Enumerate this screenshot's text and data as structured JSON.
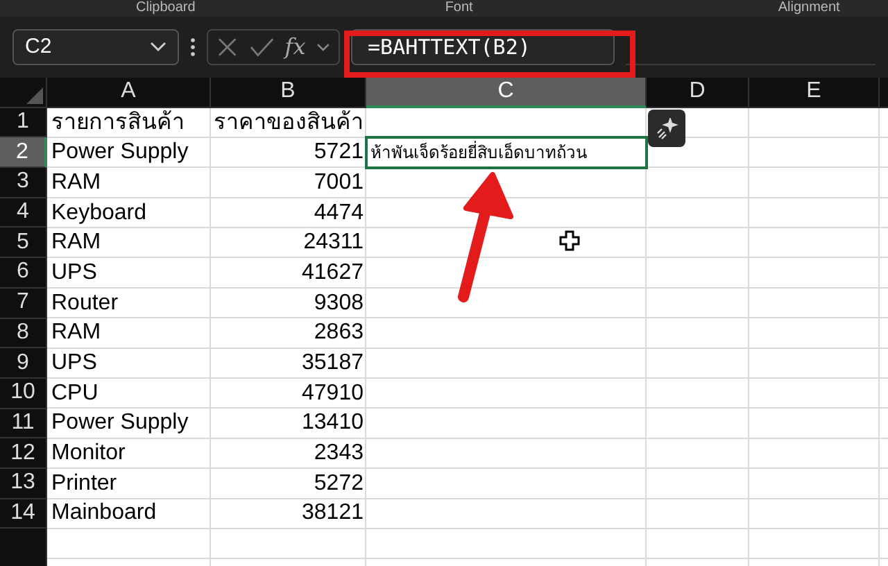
{
  "ribbon_groups": [
    "Clipboard",
    "Font",
    "Alignment"
  ],
  "formula_bar": {
    "name_box": "C2",
    "fx": "fx",
    "formula": "=BAHTTEXT(B2)",
    "highlighted": true
  },
  "columns": [
    {
      "label": "A",
      "selected": false
    },
    {
      "label": "B",
      "selected": false
    },
    {
      "label": "C",
      "selected": true
    },
    {
      "label": "D",
      "selected": false
    },
    {
      "label": "E",
      "selected": false
    }
  ],
  "rows": [
    {
      "number": "1",
      "selected": false,
      "cells": [
        "รายการสินค้า",
        "ราคาของสินค้า",
        ""
      ]
    },
    {
      "number": "2",
      "selected": true,
      "cells": [
        "Power Supply",
        "5721",
        "ห้าพันเจ็ดร้อยยี่สิบเอ็ดบาทถ้วน"
      ]
    },
    {
      "number": "3",
      "selected": false,
      "cells": [
        "RAM",
        "7001",
        ""
      ]
    },
    {
      "number": "4",
      "selected": false,
      "cells": [
        "Keyboard",
        "4474",
        ""
      ]
    },
    {
      "number": "5",
      "selected": false,
      "cells": [
        "RAM",
        "24311",
        ""
      ]
    },
    {
      "number": "6",
      "selected": false,
      "cells": [
        "UPS",
        "41627",
        ""
      ]
    },
    {
      "number": "7",
      "selected": false,
      "cells": [
        "Router",
        "9308",
        ""
      ]
    },
    {
      "number": "8",
      "selected": false,
      "cells": [
        "RAM",
        "2863",
        ""
      ]
    },
    {
      "number": "9",
      "selected": false,
      "cells": [
        "UPS",
        "35187",
        ""
      ]
    },
    {
      "number": "10",
      "selected": false,
      "cells": [
        "CPU",
        "47910",
        ""
      ]
    },
    {
      "number": "11",
      "selected": false,
      "cells": [
        "Power Supply",
        "13410",
        ""
      ]
    },
    {
      "number": "12",
      "selected": false,
      "cells": [
        "Monitor",
        "2343",
        ""
      ]
    },
    {
      "number": "13",
      "selected": false,
      "cells": [
        "Printer",
        "5272",
        ""
      ]
    },
    {
      "number": "14",
      "selected": false,
      "cells": [
        "Mainboard",
        "38121",
        ""
      ]
    }
  ]
}
